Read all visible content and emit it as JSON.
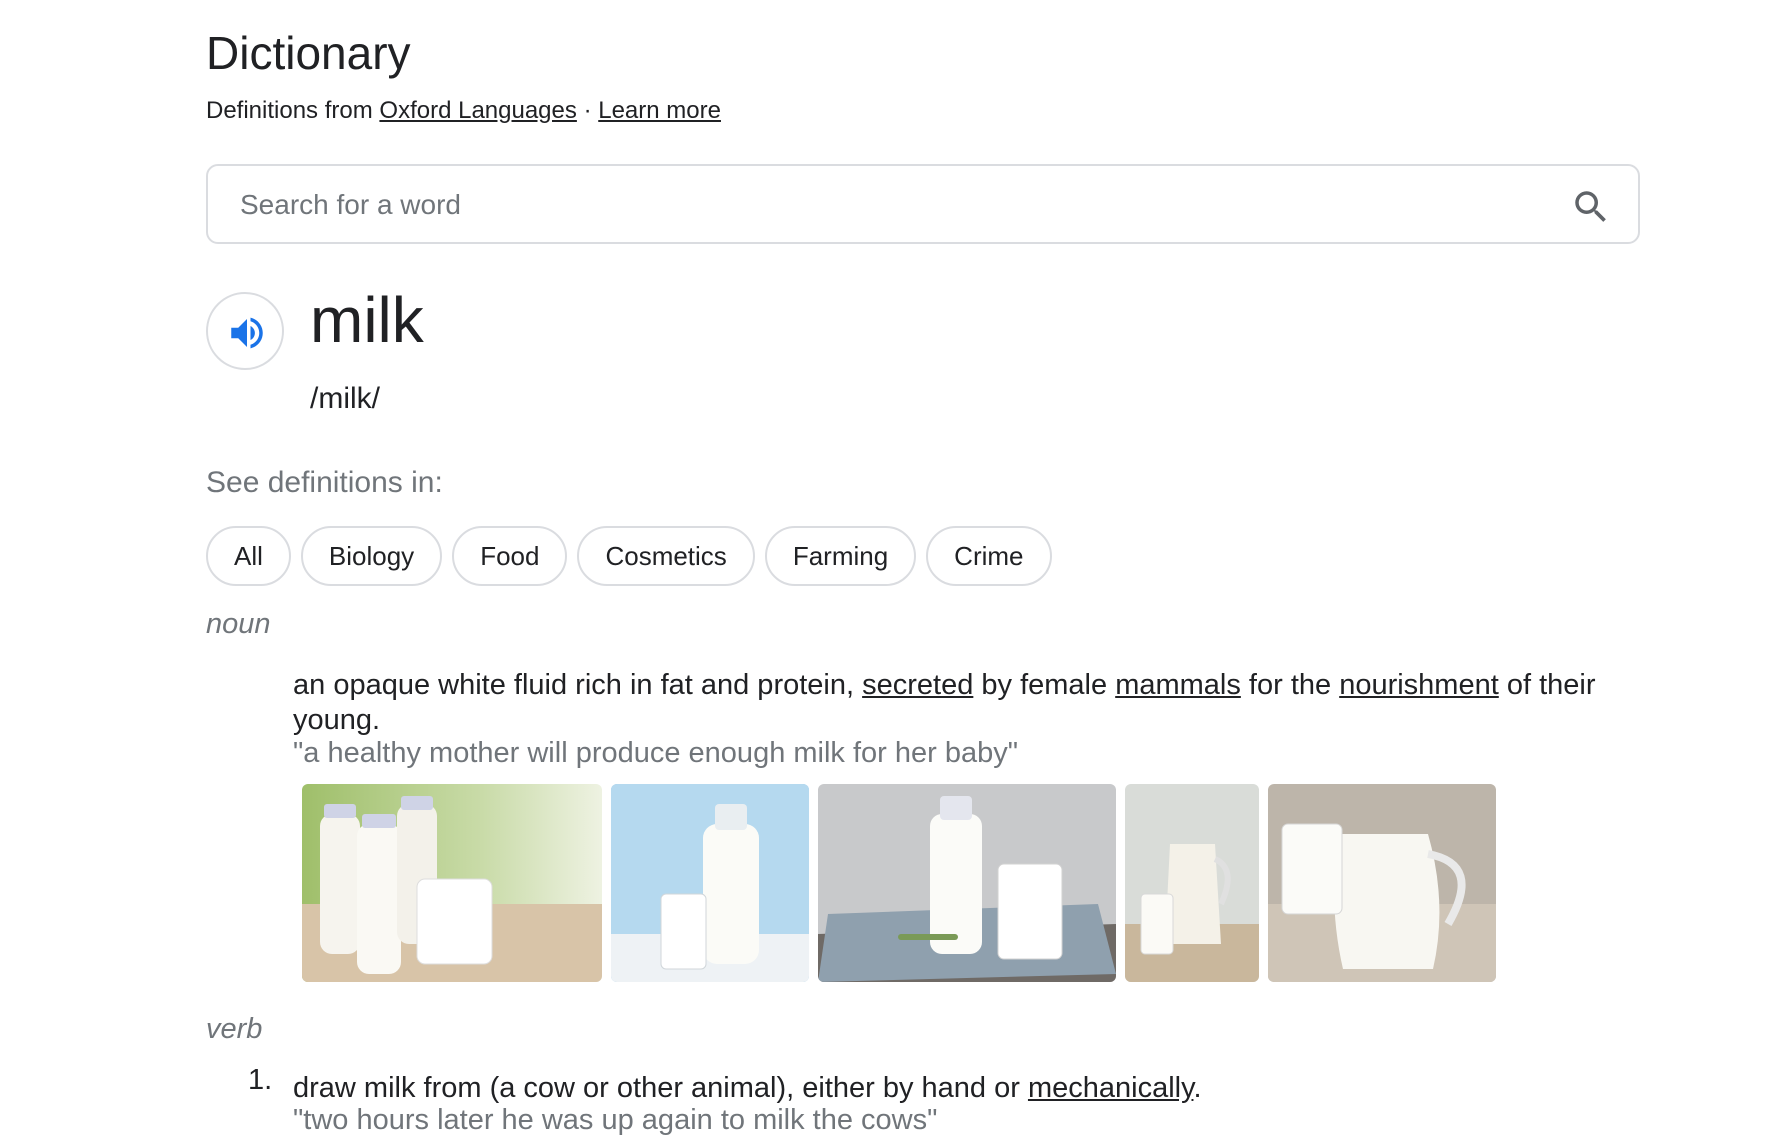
{
  "header": {
    "title": "Dictionary",
    "source_prefix": "Definitions from",
    "source_link": "Oxford Languages",
    "separator": "·",
    "learn_more": "Learn more"
  },
  "search": {
    "placeholder": "Search for a word",
    "value": ""
  },
  "entry": {
    "word": "milk",
    "phonetic": "/milk/"
  },
  "see_definitions_label": "See definitions in:",
  "chips": [
    "All",
    "Biology",
    "Food",
    "Cosmetics",
    "Farming",
    "Crime"
  ],
  "noun": {
    "pos": "noun",
    "definition": {
      "t1": "an opaque white fluid rich in fat and protein, ",
      "l1": "secreted",
      "t2": " by female ",
      "l2": "mammals",
      "t3": " for the ",
      "l3": "nourishment",
      "t4": " of their young."
    },
    "example": "\"a healthy mother will produce enough milk for her baby\""
  },
  "images": [
    "milk-bottles-image",
    "milk-bottle-glass-image",
    "milk-bottle-napkin-image",
    "milk-jug-glass-image",
    "milk-pitcher-image"
  ],
  "verb": {
    "pos": "verb",
    "number": "1.",
    "definition": {
      "t1": "draw milk from (a cow or other animal), either by hand or ",
      "l1": "mechanically",
      "t2": "."
    },
    "example": "\"two hours later he was up again to milk the cows\""
  },
  "colors": {
    "accent": "#1a73e8",
    "text": "#202124",
    "muted": "#70757a",
    "border": "#dadce0"
  }
}
